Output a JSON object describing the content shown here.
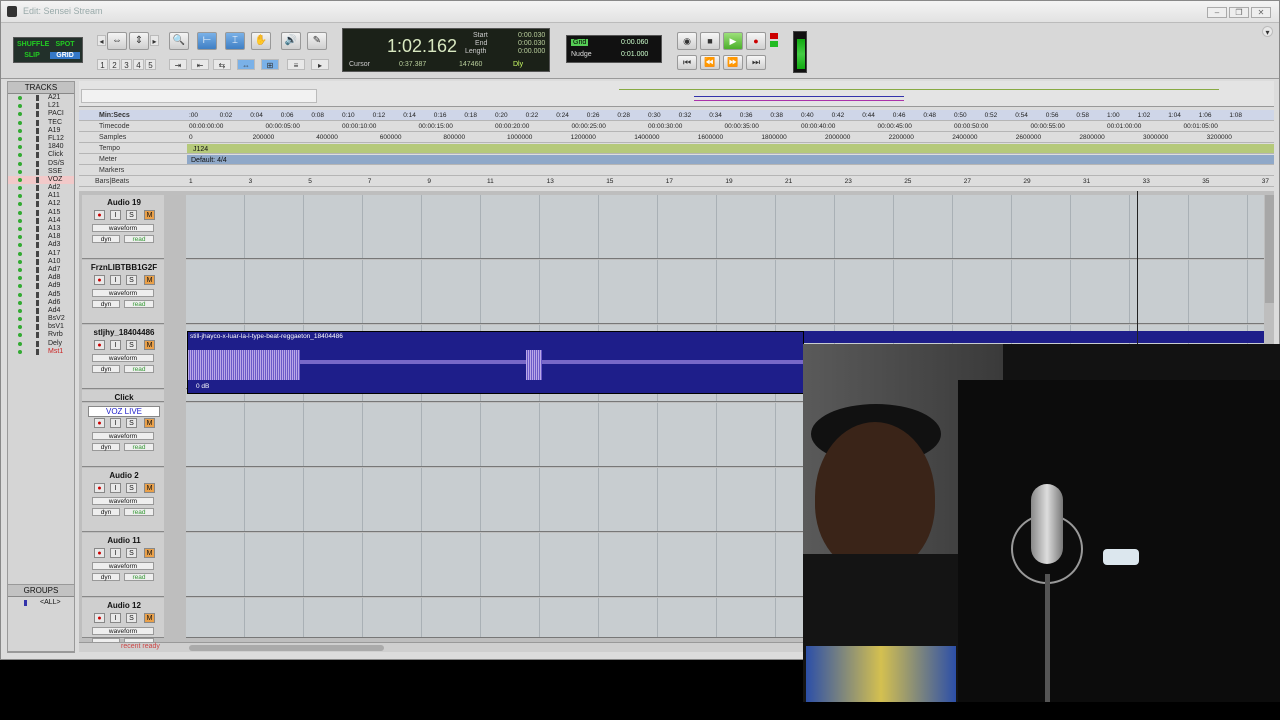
{
  "window": {
    "title": "Edit: Sensei Stream"
  },
  "toolbar": {
    "modes": [
      "SHUFFLE",
      "SPOT",
      "SLIP",
      "GRID"
    ],
    "zoom_presets": [
      "1",
      "2",
      "3",
      "4",
      "5"
    ]
  },
  "counter": {
    "main": "1:02.162",
    "cursor_label": "Cursor",
    "cursor_value": "0:37.387",
    "samples_value": "147460",
    "start_label": "Start",
    "end_label": "End",
    "length_label": "Length",
    "start_value": "0:00.030",
    "end_value": "0:00.030",
    "length_value": "0:00.000",
    "dly_label": "Dly"
  },
  "grid": {
    "grid_label": "Grid",
    "grid_value": "0:00.060",
    "nudge_label": "Nudge",
    "nudge_value": "0:01.000"
  },
  "tracks_panel": {
    "title": "TRACKS",
    "items": [
      "A21",
      "L21",
      "PACI",
      "TEC",
      "A19",
      "FL12",
      "1840",
      "Click",
      "DS/S",
      "SSE",
      "VOZ",
      "Ad2",
      "A11",
      "A12",
      "A15",
      "A14",
      "A13",
      "A18",
      "Ad3",
      "A17",
      "A10",
      "Ad7",
      "Ad8",
      "Ad9",
      "Ad5",
      "Ad6",
      "Ad4",
      "BsV2",
      "bsV1",
      "Rvrb",
      "Dely",
      "Mst1"
    ]
  },
  "groups_panel": {
    "title": "GROUPS",
    "all": "<ALL>"
  },
  "rulers": {
    "minsecs_label": "Min:Secs",
    "timecode_label": "Timecode",
    "samples_label": "Samples",
    "tempo_label": "Tempo",
    "meter_label": "Meter",
    "markers_label": "Markers",
    "bars_label": "Bars|Beats",
    "tempo_value": "J124",
    "meter_value": "Default: 4/4",
    "minsecs": [
      ":00",
      "0:02",
      "0:04",
      "0:06",
      "0:08",
      "0:10",
      "0:12",
      "0:14",
      "0:16",
      "0:18",
      "0:20",
      "0:22",
      "0:24",
      "0:26",
      "0:28",
      "0:30",
      "0:32",
      "0:34",
      "0:36",
      "0:38",
      "0:40",
      "0:42",
      "0:44",
      "0:46",
      "0:48",
      "0:50",
      "0:52",
      "0:54",
      "0:56",
      "0:58",
      "1:00",
      "1:02",
      "1:04",
      "1:06",
      "1:08"
    ],
    "timecode": [
      "00:00:00:00",
      "00:00:05:00",
      "00:00:10:00",
      "00:00:15:00",
      "00:00:20:00",
      "00:00:25:00",
      "00:00:30:00",
      "00:00:35:00",
      "00:00:40:00",
      "00:00:45:00",
      "00:00:50:00",
      "00:00:55:00",
      "00:01:00:00",
      "00:01:05:00"
    ],
    "samples": [
      "0",
      "200000",
      "400000",
      "600000",
      "800000",
      "1000000",
      "1200000",
      "1400000",
      "1600000",
      "1800000",
      "2000000",
      "2200000",
      "2400000",
      "2600000",
      "2800000",
      "3000000",
      "3200000"
    ],
    "bars": [
      "1",
      "3",
      "5",
      "7",
      "9",
      "11",
      "13",
      "15",
      "17",
      "19",
      "21",
      "23",
      "25",
      "27",
      "29",
      "31",
      "33",
      "35",
      "37"
    ]
  },
  "track_list": [
    {
      "name": "Audio 19",
      "view": "waveform",
      "auto": "read",
      "dyn": "dyn"
    },
    {
      "name": "FrznLIBTBB1G2F",
      "view": "waveform",
      "auto": "read",
      "dyn": "dyn"
    },
    {
      "name": "stljhy_18404486",
      "view": "waveform",
      "auto": "read",
      "dyn": "dyn"
    },
    {
      "name": "Click",
      "view": "",
      "auto": "",
      "dyn": ""
    },
    {
      "name": "VOZ LIVE",
      "view": "waveform",
      "auto": "read",
      "dyn": "dyn"
    },
    {
      "name": "Audio 2",
      "view": "waveform",
      "auto": "read",
      "dyn": "dyn"
    },
    {
      "name": "Audio 11",
      "view": "waveform",
      "auto": "read",
      "dyn": "dyn"
    },
    {
      "name": "Audio 12",
      "view": "waveform",
      "auto": "",
      "dyn": ""
    }
  ],
  "button_labels": {
    "rec": "●",
    "input": "I",
    "solo": "S",
    "mute": "M"
  },
  "region": {
    "name": "still-jhayco-x-luar-la-l-type-beat-reggaeton_18404486",
    "gain": "0 dB"
  },
  "status": {
    "text": "recent ready"
  }
}
